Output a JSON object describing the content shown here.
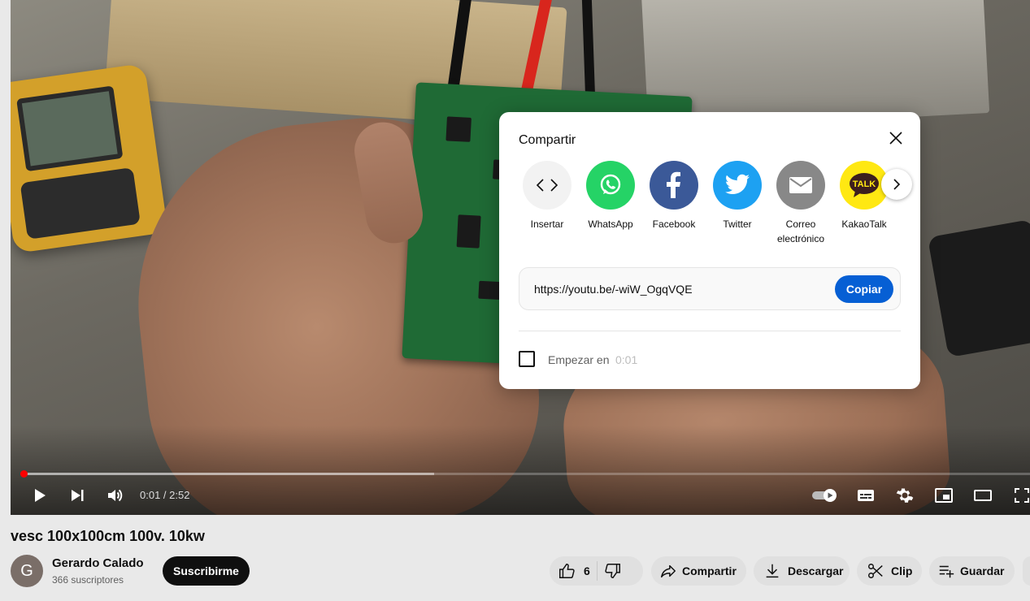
{
  "player": {
    "time_display": "0:01 / 2:52",
    "progress": {
      "played_fraction": 0.003,
      "buffered_fraction": 0.41
    }
  },
  "share_dialog": {
    "title": "Compartir",
    "targets": [
      {
        "label": "Insertar",
        "icon": "embed-icon",
        "color": "#f2f2f2"
      },
      {
        "label": "WhatsApp",
        "icon": "whatsapp-icon",
        "color": "#25d366"
      },
      {
        "label": "Facebook",
        "icon": "facebook-icon",
        "color": "#3b5998"
      },
      {
        "label": "Twitter",
        "icon": "twitter-icon",
        "color": "#1da1f2"
      },
      {
        "label": "Correo electrónico",
        "icon": "email-icon",
        "color": "#888888"
      },
      {
        "label": "KakaoTalk",
        "icon": "kakaotalk-icon",
        "color": "#ffe812"
      }
    ],
    "url": "https://youtu.be/-wiW_OgqVQE",
    "copy_label": "Copiar",
    "start_at_label": "Empezar en",
    "start_at_time": "0:01",
    "start_at_checked": false
  },
  "video": {
    "title": "vesc 100x100cm 100v. 10kw"
  },
  "channel": {
    "avatar_letter": "G",
    "name": "Gerardo Calado",
    "subscribers": "366 suscriptores",
    "subscribe_label": "Suscribirme"
  },
  "actions": {
    "like_count": "6",
    "share_label": "Compartir",
    "download_label": "Descargar",
    "clip_label": "Clip",
    "save_label": "Guardar"
  },
  "colors": {
    "accent_blue": "#065fd4",
    "progress_red": "#ff0000",
    "kakao_text": "TALK"
  }
}
